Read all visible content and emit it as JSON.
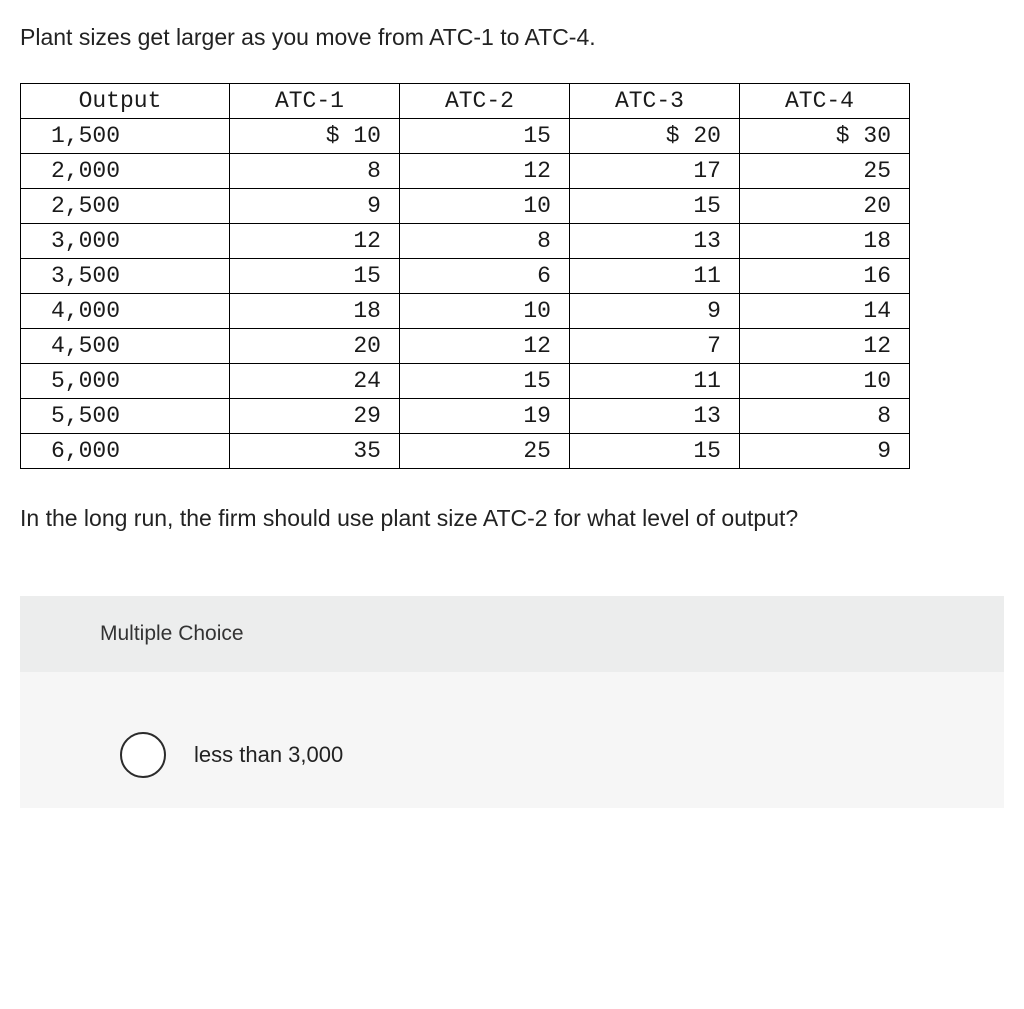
{
  "intro": "Plant sizes get larger as you move from ATC-1 to ATC-4.",
  "table": {
    "headers": [
      "Output",
      "ATC-1",
      "ATC-2",
      "ATC-3",
      "ATC-4"
    ],
    "rows": [
      [
        "1,500",
        "$ 10",
        "15",
        "$ 20",
        "$ 30"
      ],
      [
        "2,000",
        "8",
        "12",
        "17",
        "25"
      ],
      [
        "2,500",
        "9",
        "10",
        "15",
        "20"
      ],
      [
        "3,000",
        "12",
        "8",
        "13",
        "18"
      ],
      [
        "3,500",
        "15",
        "6",
        "11",
        "16"
      ],
      [
        "4,000",
        "18",
        "10",
        "9",
        "14"
      ],
      [
        "4,500",
        "20",
        "12",
        "7",
        "12"
      ],
      [
        "5,000",
        "24",
        "15",
        "11",
        "10"
      ],
      [
        "5,500",
        "29",
        "19",
        "13",
        "8"
      ],
      [
        "6,000",
        "35",
        "25",
        "15",
        "9"
      ]
    ]
  },
  "followup": "In the long run, the firm should use plant size ATC-2 for what level of output?",
  "mc": {
    "header": "Multiple Choice",
    "options": [
      {
        "label": "less than 3,000"
      }
    ]
  },
  "chart_data": {
    "type": "table",
    "title": "Average Total Cost by Plant Size and Output",
    "columns": [
      "Output",
      "ATC-1",
      "ATC-2",
      "ATC-3",
      "ATC-4"
    ],
    "rows": [
      {
        "Output": 1500,
        "ATC-1": 10,
        "ATC-2": 15,
        "ATC-3": 20,
        "ATC-4": 30
      },
      {
        "Output": 2000,
        "ATC-1": 8,
        "ATC-2": 12,
        "ATC-3": 17,
        "ATC-4": 25
      },
      {
        "Output": 2500,
        "ATC-1": 9,
        "ATC-2": 10,
        "ATC-3": 15,
        "ATC-4": 20
      },
      {
        "Output": 3000,
        "ATC-1": 12,
        "ATC-2": 8,
        "ATC-3": 13,
        "ATC-4": 18
      },
      {
        "Output": 3500,
        "ATC-1": 15,
        "ATC-2": 6,
        "ATC-3": 11,
        "ATC-4": 16
      },
      {
        "Output": 4000,
        "ATC-1": 18,
        "ATC-2": 10,
        "ATC-3": 9,
        "ATC-4": 14
      },
      {
        "Output": 4500,
        "ATC-1": 20,
        "ATC-2": 12,
        "ATC-3": 7,
        "ATC-4": 12
      },
      {
        "Output": 5000,
        "ATC-1": 24,
        "ATC-2": 15,
        "ATC-3": 11,
        "ATC-4": 10
      },
      {
        "Output": 5500,
        "ATC-1": 29,
        "ATC-2": 19,
        "ATC-3": 13,
        "ATC-4": 8
      },
      {
        "Output": 6000,
        "ATC-1": 35,
        "ATC-2": 25,
        "ATC-3": 15,
        "ATC-4": 9
      }
    ]
  }
}
